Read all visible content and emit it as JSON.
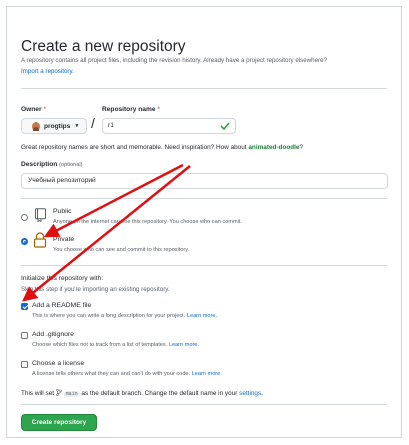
{
  "header": {
    "title": "Create a new repository",
    "subtitle": "A repository contains all project files, including the revision history. Already have a project repository elsewhere?",
    "import_link": "Import a repository."
  },
  "owner": {
    "label": "Owner",
    "required_mark": "*",
    "value": "progtips"
  },
  "repo_name": {
    "label": "Repository name",
    "required_mark": "*",
    "value": "r1",
    "separator": "/"
  },
  "name_hint": {
    "text": "Great repository names are short and memorable. Need inspiration? How about",
    "suggestion": "animated-doodle",
    "suffix": "?"
  },
  "description": {
    "label": "Description",
    "optional": "(optional)",
    "value": "Учебный репозиторий"
  },
  "visibility": {
    "public": {
      "title": "Public",
      "desc": "Anyone on the internet can see this repository. You choose who can commit."
    },
    "private": {
      "title": "Private",
      "desc": "You choose who can see and commit to this repository."
    }
  },
  "init": {
    "title": "Initialize this repository with:",
    "subtitle": "Skip this step if you're importing an existing repository.",
    "readme": {
      "label": "Add a README file",
      "desc": "This is where you can write a long description for your project.",
      "link": "Learn more."
    },
    "gitignore": {
      "label": "Add .gitignore",
      "desc": "Choose which files not to track from a list of templates.",
      "link": "Learn more."
    },
    "license": {
      "label": "Choose a license",
      "desc": "A license tells others what they can and can't do with your code.",
      "link": "Learn more."
    }
  },
  "branch_note": {
    "prefix": "This will set",
    "branch": "main",
    "middle": "as the default branch. Change the default name in your",
    "link": "settings",
    "suffix": "."
  },
  "create_button": "Create repository",
  "colors": {
    "primary_button": "#2da44e",
    "link": "#0969da",
    "required": "#cf222e",
    "annotation_arrow": "#e01010"
  },
  "icons": {
    "owner_avatar": "avatar",
    "name_valid": "check-icon",
    "public": "repo-icon",
    "private": "lock-icon",
    "branch": "git-branch-icon"
  }
}
